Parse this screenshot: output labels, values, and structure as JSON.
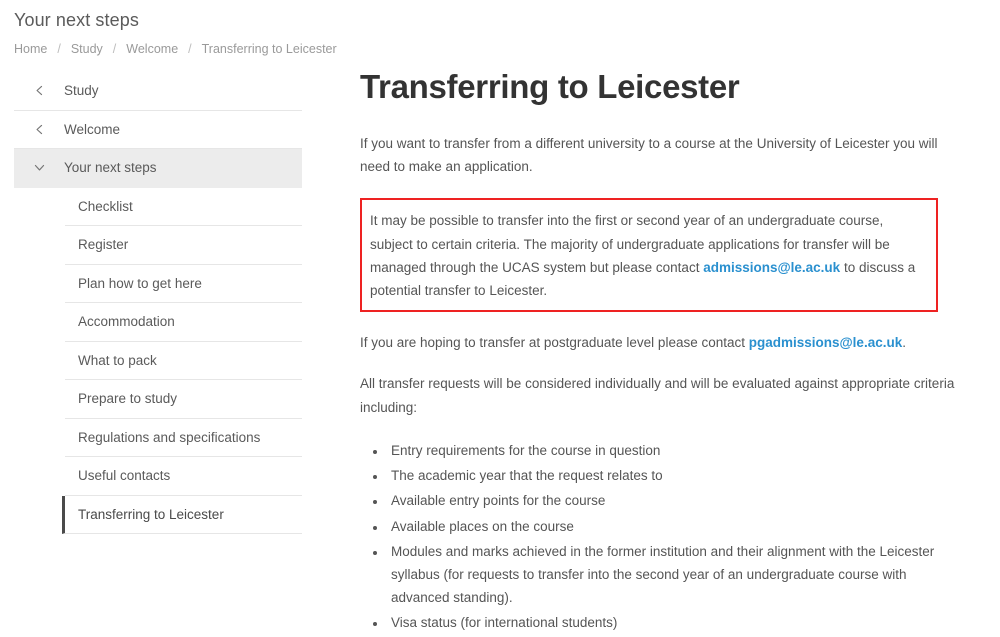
{
  "header": {
    "title": "Your next steps",
    "breadcrumb": [
      "Home",
      "Study",
      "Welcome",
      "Transferring to Leicester"
    ],
    "separator": "/"
  },
  "sidebar": {
    "top_items": [
      {
        "label": "Study",
        "icon": "chevron-left-icon",
        "state": "collapsed"
      },
      {
        "label": "Welcome",
        "icon": "chevron-left-icon",
        "state": "collapsed"
      },
      {
        "label": "Your next steps",
        "icon": "chevron-down-icon",
        "state": "expanded"
      }
    ],
    "sub_items": [
      {
        "label": "Checklist",
        "active": false
      },
      {
        "label": "Register",
        "active": false
      },
      {
        "label": "Plan how to get here",
        "active": false
      },
      {
        "label": "Accommodation",
        "active": false
      },
      {
        "label": "What to pack",
        "active": false
      },
      {
        "label": "Prepare to study",
        "active": false
      },
      {
        "label": "Regulations and specifications",
        "active": false
      },
      {
        "label": "Useful contacts",
        "active": false
      },
      {
        "label": "Transferring to Leicester",
        "active": true
      }
    ]
  },
  "main": {
    "title": "Transferring to Leicester",
    "intro": "If you want to transfer from a different university to a course at the University of Leicester you will need to make an application.",
    "callout": {
      "text_before": "It may be possible to transfer into the first or second year of an undergraduate course, subject to certain criteria. The majority of undergraduate applications for transfer will be managed through the UCAS system but please contact ",
      "link": "admissions@le.ac.uk",
      "text_after": " to discuss a potential transfer to Leicester.",
      "border_color": "#ee2222"
    },
    "postgrad": {
      "text_before": "If you are hoping to transfer at postgraduate level please contact ",
      "link": "pgadmissions@le.ac.uk",
      "text_after": "."
    },
    "criteria_intro": "All transfer requests will be considered individually and will be evaluated against appropriate criteria including:",
    "criteria": [
      "Entry requirements for the course in question",
      "The academic year that the request relates to",
      "Available entry points for the course",
      "Available places on the course",
      "Modules and marks achieved in the former institution and their alignment with the Leicester syllabus (for requests to transfer into the second year of an undergraduate course with advanced standing).",
      "Visa status (for international students)"
    ]
  },
  "colors": {
    "link": "#2a90cf",
    "callout_border": "#ee2222",
    "active_marker": "#4a4a4a",
    "expanded_row_bg": "#ececec"
  }
}
